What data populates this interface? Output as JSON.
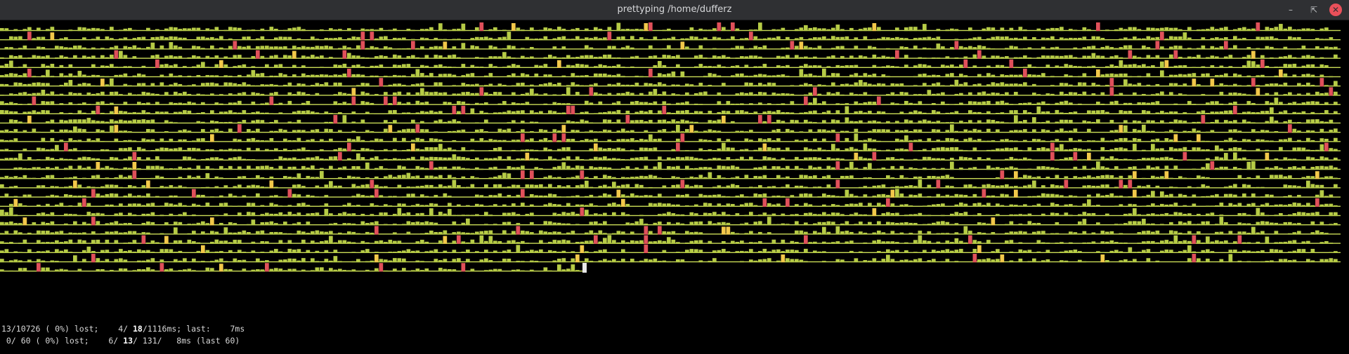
{
  "window": {
    "title": "prettyping /home/dufferz",
    "minimize_icon": "minimize-icon",
    "maximize_icon": "restore-icon",
    "close_icon": "close-icon"
  },
  "graph": {
    "colors": {
      "line": "#c9da56",
      "bar": "#b6cb46",
      "yellow": "#f2c84a",
      "red": "#e0505a",
      "bg": "#000000"
    }
  },
  "stats": {
    "line1": {
      "received": "13/10726",
      "lost_pct": " ( 0%) lost;",
      "min_label": "4/",
      "avg": "18",
      "max_label": "/1116ms; last:",
      "last": "7ms"
    },
    "line2": {
      "received": " 0/ 60",
      "lost_pct": " ( 0%) lost;",
      "min_label": "6/",
      "avg": "13",
      "max_label": "/ 131/   8ms (last 60)"
    }
  }
}
